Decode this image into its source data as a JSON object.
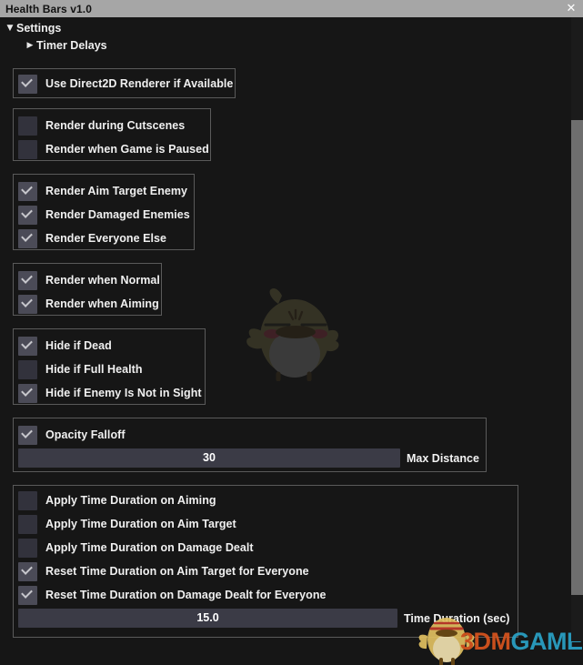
{
  "window": {
    "title": "Health Bars v1.0",
    "close_icon": "close-icon",
    "close_glyph": "✕",
    "titlebar_color": "#a6a6a6",
    "background_color": "#161616"
  },
  "tree": {
    "items": [
      {
        "label": "Settings",
        "arrow": "▼",
        "expanded": true
      },
      {
        "label": "Timer Delays",
        "arrow": "▶",
        "expanded": false
      }
    ]
  },
  "groups": [
    {
      "name": "renderer-group",
      "checkboxes": [
        {
          "label": "Use Direct2D Renderer if Available",
          "checked": true
        }
      ]
    },
    {
      "name": "render-context-group",
      "checkboxes": [
        {
          "label": "Render during Cutscenes",
          "checked": false
        },
        {
          "label": "Render when Game is Paused",
          "checked": false
        }
      ]
    },
    {
      "name": "render-targets-group",
      "checkboxes": [
        {
          "label": "Render Aim Target Enemy",
          "checked": true
        },
        {
          "label": "Render Damaged Enemies",
          "checked": true
        },
        {
          "label": "Render Everyone Else",
          "checked": true
        }
      ]
    },
    {
      "name": "render-state-group",
      "checkboxes": [
        {
          "label": "Render when Normal",
          "checked": true
        },
        {
          "label": "Render when Aiming",
          "checked": true
        }
      ]
    },
    {
      "name": "hide-rules-group",
      "checkboxes": [
        {
          "label": "Hide if Dead",
          "checked": true
        },
        {
          "label": "Hide if Full Health",
          "checked": false
        },
        {
          "label": "Hide if Enemy Is Not in Sight",
          "checked": true
        }
      ]
    },
    {
      "name": "opacity-falloff-group",
      "checkboxes": [
        {
          "label": "Opacity Falloff",
          "checked": true
        }
      ],
      "slider": {
        "value": "30",
        "caption": "Max Distance"
      }
    },
    {
      "name": "time-duration-group",
      "checkboxes": [
        {
          "label": "Apply Time Duration on Aiming",
          "checked": false
        },
        {
          "label": "Apply Time Duration on Aim Target",
          "checked": false
        },
        {
          "label": "Apply Time Duration on Damage Dealt",
          "checked": false
        },
        {
          "label": "Reset Time Duration on Aim Target for Everyone",
          "checked": true
        },
        {
          "label": "Reset Time Duration on Damage Dealt for Everyone",
          "checked": true
        }
      ],
      "slider": {
        "value": "15.0",
        "caption": "Time Duration (sec)"
      }
    }
  ],
  "watermark": {
    "logo_part1": "3DM",
    "logo_part2": "GAME",
    "logo_color1": "#d9541e",
    "logo_color2": "#2aa3c7",
    "mascot_icon": "bird-mascot-icon"
  },
  "scrollbar": {
    "orientation": "vertical",
    "thumb_color": "#6e6e6e"
  }
}
